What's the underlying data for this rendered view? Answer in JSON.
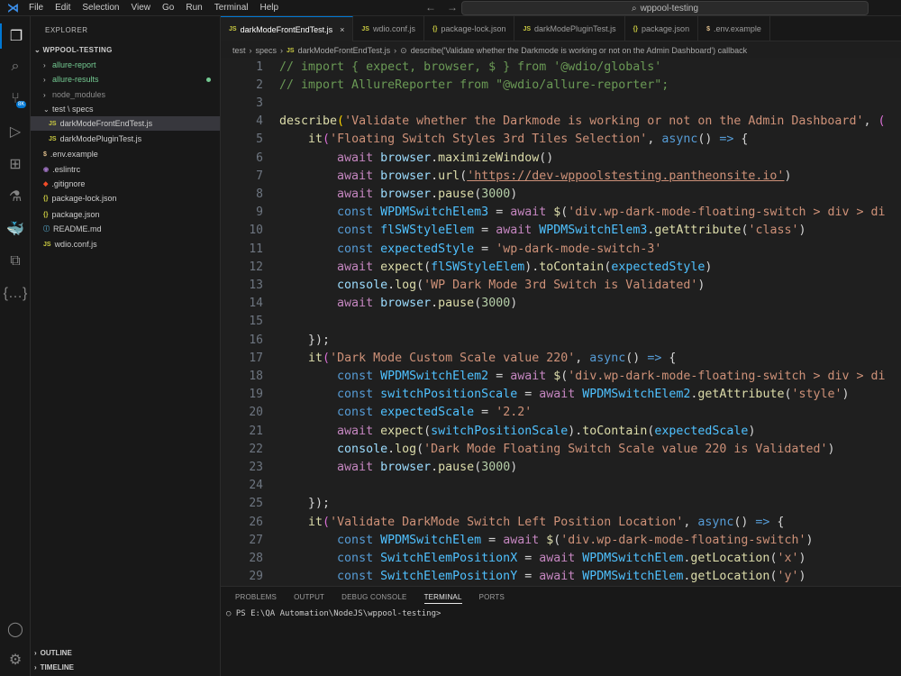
{
  "menu": [
    "File",
    "Edit",
    "Selection",
    "View",
    "Go",
    "Run",
    "Terminal",
    "Help"
  ],
  "search_placeholder": "wppool-testing",
  "explorer": {
    "title": "EXPLORER",
    "project": "WPPOOL-TESTING",
    "items": [
      {
        "label": "allure-report",
        "kind": "folder",
        "chev": "›"
      },
      {
        "label": "allure-results",
        "kind": "folder",
        "chev": "›",
        "status": "modified"
      },
      {
        "label": "node_modules",
        "kind": "folder",
        "chev": "›"
      },
      {
        "label": "test \\ specs",
        "kind": "folder",
        "chev": "⌄"
      },
      {
        "label": "darkModeFrontEndTest.js",
        "kind": "js",
        "icon": "JS",
        "selected": true
      },
      {
        "label": "darkModePluginTest.js",
        "kind": "js",
        "icon": "JS"
      },
      {
        "label": ".env.example",
        "kind": "env",
        "icon": "$"
      },
      {
        "label": ".eslintrc",
        "kind": "eslint",
        "icon": "◉"
      },
      {
        "label": ".gitignore",
        "kind": "git",
        "icon": "◆"
      },
      {
        "label": "package-lock.json",
        "kind": "json",
        "icon": "{}"
      },
      {
        "label": "package.json",
        "kind": "json",
        "icon": "{}"
      },
      {
        "label": "README.md",
        "kind": "md",
        "icon": "ⓘ"
      },
      {
        "label": "wdio.conf.js",
        "kind": "js",
        "icon": "JS"
      }
    ],
    "outline": "OUTLINE",
    "timeline": "TIMELINE"
  },
  "tabs": [
    {
      "label": "darkModeFrontEndTest.js",
      "icon": "JS",
      "active": true
    },
    {
      "label": "wdio.conf.js",
      "icon": "JS"
    },
    {
      "label": "package-lock.json",
      "icon": "{}"
    },
    {
      "label": "darkModePluginTest.js",
      "icon": "JS"
    },
    {
      "label": "package.json",
      "icon": "{}"
    },
    {
      "label": ".env.example",
      "icon": "$"
    }
  ],
  "breadcrumb": [
    "test",
    "specs",
    "darkModeFrontEndTest.js",
    "describe('Validate whether the Darkmode is working or not on the Admin Dashboard') callback"
  ],
  "code": [
    {
      "n": "1",
      "tokens": [
        [
          "t-com",
          "// import { expect, browser, $ } from '@wdio/globals'"
        ]
      ]
    },
    {
      "n": "2",
      "tokens": [
        [
          "t-com",
          "// import AllureReporter from \"@wdio/allure-reporter\";"
        ]
      ]
    },
    {
      "n": "3",
      "tokens": []
    },
    {
      "n": "4",
      "tokens": [
        [
          "t-fn",
          "describe"
        ],
        [
          "t-br",
          "("
        ],
        [
          "t-str",
          "'Validate whether the Darkmode is working or not on the Admin Dashboard'"
        ],
        [
          "t-pl",
          ", "
        ],
        [
          "t-br2",
          "("
        ]
      ]
    },
    {
      "n": "5",
      "tokens": [
        [
          "t-pl",
          "    "
        ],
        [
          "t-fn",
          "it"
        ],
        [
          "t-br2",
          "("
        ],
        [
          "t-str",
          "'Floating Switch Styles 3rd Tiles Selection'"
        ],
        [
          "t-pl",
          ", "
        ],
        [
          "t-kw",
          "async"
        ],
        [
          "t-pl",
          "() "
        ],
        [
          "t-kw",
          "=>"
        ],
        [
          "t-pl",
          " {"
        ]
      ]
    },
    {
      "n": "6",
      "tokens": [
        [
          "t-pl",
          "        "
        ],
        [
          "t-ctl",
          "await"
        ],
        [
          "t-pl",
          " "
        ],
        [
          "t-var",
          "browser"
        ],
        [
          "t-pl",
          "."
        ],
        [
          "t-fn",
          "maximizeWindow"
        ],
        [
          "t-pl",
          "()"
        ]
      ]
    },
    {
      "n": "7",
      "tokens": [
        [
          "t-pl",
          "        "
        ],
        [
          "t-ctl",
          "await"
        ],
        [
          "t-pl",
          " "
        ],
        [
          "t-var",
          "browser"
        ],
        [
          "t-pl",
          "."
        ],
        [
          "t-fn",
          "url"
        ],
        [
          "t-pl",
          "("
        ],
        [
          "t-str",
          "'https://dev-wppoolstesting.pantheonsite.io'"
        ],
        [
          "t-pl",
          ")"
        ]
      ]
    },
    {
      "n": "8",
      "tokens": [
        [
          "t-pl",
          "        "
        ],
        [
          "t-ctl",
          "await"
        ],
        [
          "t-pl",
          " "
        ],
        [
          "t-var",
          "browser"
        ],
        [
          "t-pl",
          "."
        ],
        [
          "t-fn",
          "pause"
        ],
        [
          "t-pl",
          "("
        ],
        [
          "t-num",
          "3000"
        ],
        [
          "t-pl",
          ")"
        ]
      ]
    },
    {
      "n": "9",
      "tokens": [
        [
          "t-pl",
          "        "
        ],
        [
          "t-kw",
          "const"
        ],
        [
          "t-pl",
          " "
        ],
        [
          "t-const",
          "WPDMSwitchElem3"
        ],
        [
          "t-pl",
          " = "
        ],
        [
          "t-ctl",
          "await"
        ],
        [
          "t-pl",
          " "
        ],
        [
          "t-fn",
          "$"
        ],
        [
          "t-pl",
          "("
        ],
        [
          "t-str",
          "'div.wp-dark-mode-floating-switch > div > di"
        ]
      ]
    },
    {
      "n": "10",
      "tokens": [
        [
          "t-pl",
          "        "
        ],
        [
          "t-kw",
          "const"
        ],
        [
          "t-pl",
          " "
        ],
        [
          "t-const",
          "flSWStyleElem"
        ],
        [
          "t-pl",
          " = "
        ],
        [
          "t-ctl",
          "await"
        ],
        [
          "t-pl",
          " "
        ],
        [
          "t-const",
          "WPDMSwitchElem3"
        ],
        [
          "t-pl",
          "."
        ],
        [
          "t-fn",
          "getAttribute"
        ],
        [
          "t-pl",
          "("
        ],
        [
          "t-str",
          "'class'"
        ],
        [
          "t-pl",
          ")"
        ]
      ]
    },
    {
      "n": "11",
      "tokens": [
        [
          "t-pl",
          "        "
        ],
        [
          "t-kw",
          "const"
        ],
        [
          "t-pl",
          " "
        ],
        [
          "t-const",
          "expectedStyle"
        ],
        [
          "t-pl",
          " = "
        ],
        [
          "t-str",
          "'wp-dark-mode-switch-3'"
        ]
      ]
    },
    {
      "n": "12",
      "tokens": [
        [
          "t-pl",
          "        "
        ],
        [
          "t-ctl",
          "await"
        ],
        [
          "t-pl",
          " "
        ],
        [
          "t-fn",
          "expect"
        ],
        [
          "t-pl",
          "("
        ],
        [
          "t-const",
          "flSWStyleElem"
        ],
        [
          "t-pl",
          ")."
        ],
        [
          "t-fn",
          "toContain"
        ],
        [
          "t-pl",
          "("
        ],
        [
          "t-const",
          "expectedStyle"
        ],
        [
          "t-pl",
          ")"
        ]
      ]
    },
    {
      "n": "13",
      "tokens": [
        [
          "t-pl",
          "        "
        ],
        [
          "t-var",
          "console"
        ],
        [
          "t-pl",
          "."
        ],
        [
          "t-fn",
          "log"
        ],
        [
          "t-pl",
          "("
        ],
        [
          "t-str",
          "'WP Dark Mode 3rd Switch is Validated'"
        ],
        [
          "t-pl",
          ")"
        ]
      ]
    },
    {
      "n": "14",
      "tokens": [
        [
          "t-pl",
          "        "
        ],
        [
          "t-ctl",
          "await"
        ],
        [
          "t-pl",
          " "
        ],
        [
          "t-var",
          "browser"
        ],
        [
          "t-pl",
          "."
        ],
        [
          "t-fn",
          "pause"
        ],
        [
          "t-pl",
          "("
        ],
        [
          "t-num",
          "3000"
        ],
        [
          "t-pl",
          ")"
        ]
      ]
    },
    {
      "n": "15",
      "tokens": []
    },
    {
      "n": "16",
      "tokens": [
        [
          "t-pl",
          "    "
        ],
        [
          "t-pl",
          "})"
        ],
        [
          "t-pl",
          ";"
        ]
      ]
    },
    {
      "n": "17",
      "tokens": [
        [
          "t-pl",
          "    "
        ],
        [
          "t-fn",
          "it"
        ],
        [
          "t-br2",
          "("
        ],
        [
          "t-str",
          "'Dark Mode Custom Scale value 220'"
        ],
        [
          "t-pl",
          ", "
        ],
        [
          "t-kw",
          "async"
        ],
        [
          "t-pl",
          "() "
        ],
        [
          "t-kw",
          "=>"
        ],
        [
          "t-pl",
          " {"
        ]
      ]
    },
    {
      "n": "18",
      "tokens": [
        [
          "t-pl",
          "        "
        ],
        [
          "t-kw",
          "const"
        ],
        [
          "t-pl",
          " "
        ],
        [
          "t-const",
          "WPDMSwitchElem2"
        ],
        [
          "t-pl",
          " = "
        ],
        [
          "t-ctl",
          "await"
        ],
        [
          "t-pl",
          " "
        ],
        [
          "t-fn",
          "$"
        ],
        [
          "t-pl",
          "("
        ],
        [
          "t-str",
          "'div.wp-dark-mode-floating-switch > div > di"
        ]
      ]
    },
    {
      "n": "19",
      "tokens": [
        [
          "t-pl",
          "        "
        ],
        [
          "t-kw",
          "const"
        ],
        [
          "t-pl",
          " "
        ],
        [
          "t-const",
          "switchPositionScale"
        ],
        [
          "t-pl",
          " = "
        ],
        [
          "t-ctl",
          "await"
        ],
        [
          "t-pl",
          " "
        ],
        [
          "t-const",
          "WPDMSwitchElem2"
        ],
        [
          "t-pl",
          "."
        ],
        [
          "t-fn",
          "getAttribute"
        ],
        [
          "t-pl",
          "("
        ],
        [
          "t-str",
          "'style'"
        ],
        [
          "t-pl",
          ")"
        ]
      ]
    },
    {
      "n": "20",
      "tokens": [
        [
          "t-pl",
          "        "
        ],
        [
          "t-kw",
          "const"
        ],
        [
          "t-pl",
          " "
        ],
        [
          "t-const",
          "expectedScale"
        ],
        [
          "t-pl",
          " = "
        ],
        [
          "t-str",
          "'2.2'"
        ]
      ]
    },
    {
      "n": "21",
      "tokens": [
        [
          "t-pl",
          "        "
        ],
        [
          "t-ctl",
          "await"
        ],
        [
          "t-pl",
          " "
        ],
        [
          "t-fn",
          "expect"
        ],
        [
          "t-pl",
          "("
        ],
        [
          "t-const",
          "switchPositionScale"
        ],
        [
          "t-pl",
          ")."
        ],
        [
          "t-fn",
          "toContain"
        ],
        [
          "t-pl",
          "("
        ],
        [
          "t-const",
          "expectedScale"
        ],
        [
          "t-pl",
          ")"
        ]
      ]
    },
    {
      "n": "22",
      "tokens": [
        [
          "t-pl",
          "        "
        ],
        [
          "t-var",
          "console"
        ],
        [
          "t-pl",
          "."
        ],
        [
          "t-fn",
          "log"
        ],
        [
          "t-pl",
          "("
        ],
        [
          "t-str",
          "'Dark Mode Floating Switch Scale value 220 is Validated'"
        ],
        [
          "t-pl",
          ")"
        ]
      ]
    },
    {
      "n": "23",
      "tokens": [
        [
          "t-pl",
          "        "
        ],
        [
          "t-ctl",
          "await"
        ],
        [
          "t-pl",
          " "
        ],
        [
          "t-var",
          "browser"
        ],
        [
          "t-pl",
          "."
        ],
        [
          "t-fn",
          "pause"
        ],
        [
          "t-pl",
          "("
        ],
        [
          "t-num",
          "3000"
        ],
        [
          "t-pl",
          ")"
        ]
      ]
    },
    {
      "n": "24",
      "tokens": []
    },
    {
      "n": "25",
      "tokens": [
        [
          "t-pl",
          "    "
        ],
        [
          "t-pl",
          "})"
        ],
        [
          "t-pl",
          ";"
        ]
      ]
    },
    {
      "n": "26",
      "tokens": [
        [
          "t-pl",
          "    "
        ],
        [
          "t-fn",
          "it"
        ],
        [
          "t-br2",
          "("
        ],
        [
          "t-str",
          "'Validate DarkMode Switch Left Position Location'"
        ],
        [
          "t-pl",
          ", "
        ],
        [
          "t-kw",
          "async"
        ],
        [
          "t-pl",
          "() "
        ],
        [
          "t-kw",
          "=>"
        ],
        [
          "t-pl",
          " {"
        ]
      ]
    },
    {
      "n": "27",
      "tokens": [
        [
          "t-pl",
          "        "
        ],
        [
          "t-kw",
          "const"
        ],
        [
          "t-pl",
          " "
        ],
        [
          "t-const",
          "WPDMSwitchElem"
        ],
        [
          "t-pl",
          " = "
        ],
        [
          "t-ctl",
          "await"
        ],
        [
          "t-pl",
          " "
        ],
        [
          "t-fn",
          "$"
        ],
        [
          "t-pl",
          "("
        ],
        [
          "t-str",
          "'div.wp-dark-mode-floating-switch'"
        ],
        [
          "t-pl",
          ")"
        ]
      ]
    },
    {
      "n": "28",
      "tokens": [
        [
          "t-pl",
          "        "
        ],
        [
          "t-kw",
          "const"
        ],
        [
          "t-pl",
          " "
        ],
        [
          "t-const",
          "SwitchElemPositionX"
        ],
        [
          "t-pl",
          " = "
        ],
        [
          "t-ctl",
          "await"
        ],
        [
          "t-pl",
          " "
        ],
        [
          "t-const",
          "WPDMSwitchElem"
        ],
        [
          "t-pl",
          "."
        ],
        [
          "t-fn",
          "getLocation"
        ],
        [
          "t-pl",
          "("
        ],
        [
          "t-str",
          "'x'"
        ],
        [
          "t-pl",
          ")"
        ]
      ]
    },
    {
      "n": "29",
      "tokens": [
        [
          "t-pl",
          "        "
        ],
        [
          "t-kw",
          "const"
        ],
        [
          "t-pl",
          " "
        ],
        [
          "t-const",
          "SwitchElemPositionY"
        ],
        [
          "t-pl",
          " = "
        ],
        [
          "t-ctl",
          "await"
        ],
        [
          "t-pl",
          " "
        ],
        [
          "t-const",
          "WPDMSwitchElem"
        ],
        [
          "t-pl",
          "."
        ],
        [
          "t-fn",
          "getLocation"
        ],
        [
          "t-pl",
          "("
        ],
        [
          "t-str",
          "'y'"
        ],
        [
          "t-pl",
          ")"
        ]
      ]
    }
  ],
  "panel_tabs": [
    "PROBLEMS",
    "OUTPUT",
    "DEBUG CONSOLE",
    "TERMINAL",
    "PORTS"
  ],
  "active_panel_tab": "TERMINAL",
  "terminal_prompt": "PS E:\\QA Automation\\NodeJS\\wppool-testing>"
}
